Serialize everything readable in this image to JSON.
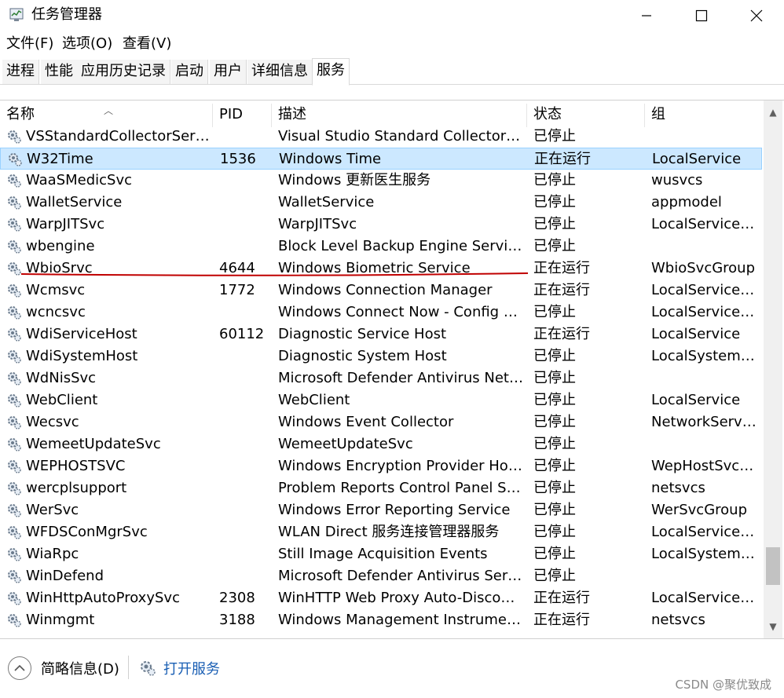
{
  "window": {
    "title": "任务管理器"
  },
  "menu": [
    "文件(F)",
    "选项(O)",
    "查看(V)"
  ],
  "tabs": [
    {
      "label": "进程"
    },
    {
      "label": "性能"
    },
    {
      "label": "应用历史记录"
    },
    {
      "label": "启动"
    },
    {
      "label": "用户"
    },
    {
      "label": "详细信息"
    },
    {
      "label": "服务",
      "active": true
    }
  ],
  "columns": [
    "名称",
    "PID",
    "描述",
    "状态",
    "组"
  ],
  "rows": [
    {
      "name": "VSStandardCollectorServi...",
      "pid": "",
      "desc": "Visual Studio Standard Collector S...",
      "status": "已停止",
      "group": ""
    },
    {
      "name": "W32Time",
      "pid": "1536",
      "desc": "Windows Time",
      "status": "正在运行",
      "group": "LocalService",
      "selected": true
    },
    {
      "name": "WaaSMedicSvc",
      "pid": "",
      "desc": "Windows 更新医生服务",
      "status": "已停止",
      "group": "wusvcs"
    },
    {
      "name": "WalletService",
      "pid": "",
      "desc": "WalletService",
      "status": "已停止",
      "group": "appmodel"
    },
    {
      "name": "WarpJITSvc",
      "pid": "",
      "desc": "WarpJITSvc",
      "status": "已停止",
      "group": "LocalServiceN..."
    },
    {
      "name": "wbengine",
      "pid": "",
      "desc": "Block Level Backup Engine Service",
      "status": "已停止",
      "group": ""
    },
    {
      "name": "WbioSrvc",
      "pid": "4644",
      "desc": "Windows Biometric Service",
      "status": "正在运行",
      "group": "WbioSvcGroup"
    },
    {
      "name": "Wcmsvc",
      "pid": "1772",
      "desc": "Windows Connection Manager",
      "status": "正在运行",
      "group": "LocalServiceN..."
    },
    {
      "name": "wcncsvc",
      "pid": "",
      "desc": "Windows Connect Now - Config R...",
      "status": "已停止",
      "group": "LocalServiceA..."
    },
    {
      "name": "WdiServiceHost",
      "pid": "60112",
      "desc": "Diagnostic Service Host",
      "status": "正在运行",
      "group": "LocalService"
    },
    {
      "name": "WdiSystemHost",
      "pid": "",
      "desc": "Diagnostic System Host",
      "status": "已停止",
      "group": "LocalSystemN..."
    },
    {
      "name": "WdNisSvc",
      "pid": "",
      "desc": "Microsoft Defender Antivirus Netw...",
      "status": "已停止",
      "group": ""
    },
    {
      "name": "WebClient",
      "pid": "",
      "desc": "WebClient",
      "status": "已停止",
      "group": "LocalService"
    },
    {
      "name": "Wecsvc",
      "pid": "",
      "desc": "Windows Event Collector",
      "status": "已停止",
      "group": "NetworkService"
    },
    {
      "name": "WemeetUpdateSvc",
      "pid": "",
      "desc": "WemeetUpdateSvc",
      "status": "已停止",
      "group": ""
    },
    {
      "name": "WEPHOSTSVC",
      "pid": "",
      "desc": "Windows Encryption Provider Host...",
      "status": "已停止",
      "group": "WepHostSvcG..."
    },
    {
      "name": "wercplsupport",
      "pid": "",
      "desc": "Problem Reports Control Panel Su...",
      "status": "已停止",
      "group": "netsvcs"
    },
    {
      "name": "WerSvc",
      "pid": "",
      "desc": "Windows Error Reporting Service",
      "status": "已停止",
      "group": "WerSvcGroup"
    },
    {
      "name": "WFDSConMgrSvc",
      "pid": "",
      "desc": "WLAN Direct 服务连接管理器服务",
      "status": "已停止",
      "group": "LocalServiceN..."
    },
    {
      "name": "WiaRpc",
      "pid": "",
      "desc": "Still Image Acquisition Events",
      "status": "已停止",
      "group": "LocalSystemN..."
    },
    {
      "name": "WinDefend",
      "pid": "",
      "desc": "Microsoft Defender Antivirus Servi...",
      "status": "已停止",
      "group": ""
    },
    {
      "name": "WinHttpAutoProxySvc",
      "pid": "2308",
      "desc": "WinHTTP Web Proxy Auto-Discove...",
      "status": "正在运行",
      "group": "LocalServiceN..."
    },
    {
      "name": "Winmgmt",
      "pid": "3188",
      "desc": "Windows Management Instrument...",
      "status": "正在运行",
      "group": "netsvcs"
    }
  ],
  "footer": {
    "fewer_details": "简略信息(D)",
    "open_services": "打开服务"
  },
  "watermark": "CSDN @聚优致成",
  "colors": {
    "selected_row": "#cce8ff",
    "annotation_underline": "#c00000",
    "link": "#1a5fb4"
  }
}
